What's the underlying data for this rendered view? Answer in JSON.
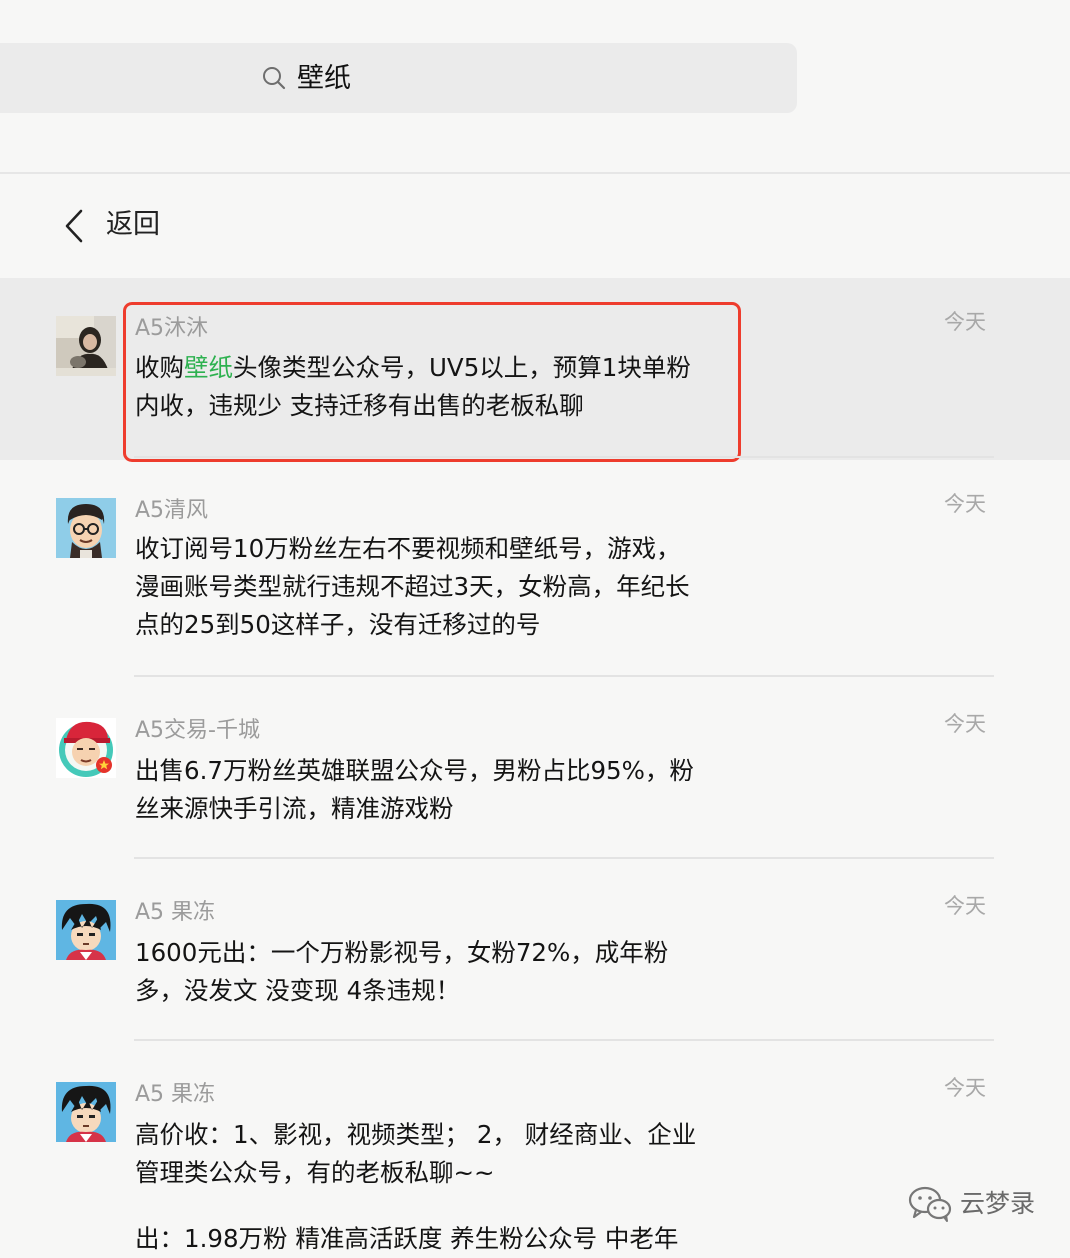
{
  "search": {
    "query": "壁纸"
  },
  "nav": {
    "back_label": "返回"
  },
  "results": [
    {
      "sender": "A5沐沐",
      "time": "今天",
      "avatar": "photo-avatar",
      "selected": true,
      "lines": [
        {
          "before": "收购",
          "highlight": "壁纸",
          "after": "头像类型公众号，UV5以上，预算1块单粉"
        },
        {
          "text": "内收，违规少 支持迁移有出售的老板私聊"
        }
      ]
    },
    {
      "sender": "A5清风",
      "time": "今天",
      "avatar": "cartoon-glasses-avatar",
      "lines": [
        {
          "text": "收订阅号10万粉丝左右不要视频和壁纸号，游戏，"
        },
        {
          "text": "漫画账号类型就行违规不超过3天，女粉高，年纪长"
        },
        {
          "text": "点的25到50这样子，没有迁移过的号"
        }
      ]
    },
    {
      "sender": "A5交易-千城",
      "time": "今天",
      "avatar": "cartoon-cap-avatar",
      "lines": [
        {
          "text": "出售6.7万粉丝英雄联盟公众号，男粉占比95%，粉"
        },
        {
          "text": "丝来源快手引流，精准游戏粉"
        }
      ]
    },
    {
      "sender": "A5  果冻",
      "time": "今天",
      "avatar": "cartoon-hair-avatar",
      "lines": [
        {
          "text": "1600元出：一个万粉影视号，女粉72%，成年粉"
        },
        {
          "text": "多，没发文 没变现  4条违规！"
        }
      ]
    },
    {
      "sender": "A5  果冻",
      "time": "今天",
      "avatar": "cartoon-hair-avatar",
      "lines": [
        {
          "text": "高价收：1、影视，视频类型； 2，  财经商业、企业"
        },
        {
          "text": "管理类公众号，有的老板私聊~~"
        },
        {
          "text": ""
        },
        {
          "text": "出：1.98万粉 精准高活跃度  养生粉公众号    中老年"
        }
      ]
    }
  ],
  "watermark": {
    "text": "云梦录",
    "icon": "wechat-icon"
  },
  "colors": {
    "highlight": "#2db14f",
    "frame": "#ee3c2d",
    "selected_bg": "#ebebeb"
  }
}
